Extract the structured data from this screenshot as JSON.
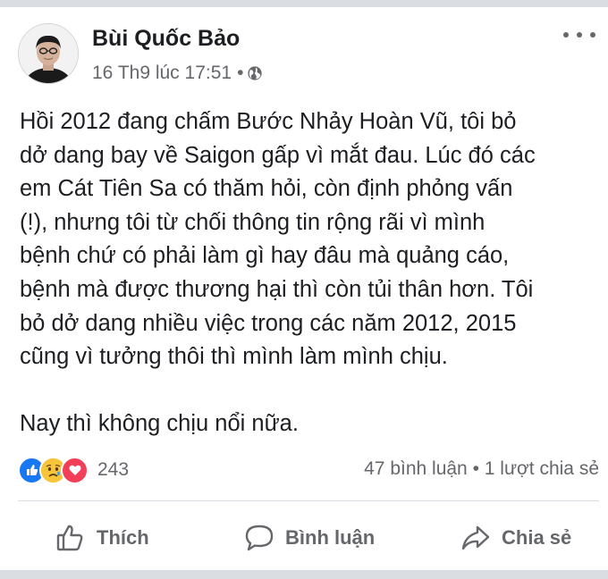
{
  "post": {
    "author": "Bùi Quốc Bảo",
    "timestamp": "16 Th9 lúc 17:51",
    "separator": "•",
    "privacy_icon": "globe-icon",
    "more_icon": "more-options-icon",
    "body_lines_p1": [
      "Hồi 2012 đang chấm Bước Nhảy Hoàn Vũ, tôi bỏ",
      "dở dang bay về Saigon gấp vì mắt đau. Lúc đó các",
      "em Cát Tiên Sa có thăm hỏi, còn định phỏng vấn",
      "(!), nhưng tôi từ chối thông tin rộng rãi vì mình",
      "bệnh chứ có phải làm gì hay đâu mà quảng cáo,",
      "bệnh mà được thương hại thì còn tủi thân hơn. Tôi",
      "bỏ dở dang nhiều việc trong các năm 2012, 2015",
      "cũng vì tưởng thôi thì mình làm mình chịu."
    ],
    "body_p2": "Nay thì không chịu nổi nữa."
  },
  "reactions": {
    "icons": [
      "like-icon",
      "sad-icon",
      "love-icon"
    ],
    "count": "243",
    "comments": "47 bình luận",
    "stat_separator": "•",
    "shares": "1 lượt chia sẻ"
  },
  "actions": {
    "like_label": "Thích",
    "comment_label": "Bình luận",
    "share_label": "Chia sẻ"
  },
  "colors": {
    "like_blue": "#1877f2",
    "love_red": "#f33e58",
    "sad_yellow": "#f7b928",
    "muted_text": "#65676b",
    "divider": "#dadde1"
  }
}
